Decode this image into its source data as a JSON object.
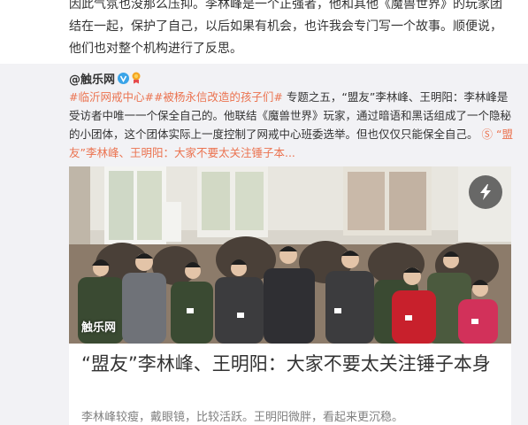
{
  "intro": {
    "lines": [
      "因此气氛也没那么压抑。李林峰是一个正强者，他和其他《魔兽世界》的玩家团",
      "结在一起，保护了自己，以后如果有机会，也许我会专门写一个故事。顺便说，",
      "他们也对整个机构进行了反思。"
    ]
  },
  "repost": {
    "author": "@触乐网",
    "topic1": "#临沂网戒中心#",
    "topic2": "#被杨永信改造的孩子们#",
    "text_a": " 专题之五，“盟友”李林峰、王明阳：李林峰是受访者中唯一一个保全自己的。他联结《魔兽世界》玩家，通过暗语和黑话组成了一个隐秘的小团体，这个团体实际上一度控制了网戒中心班委选举。但也仅仅只能保全自己。",
    "link_icon": "Ⓢ",
    "link_text": "“盟友”李林峰、王明阳：大家不要太关注锤子本...",
    "card": {
      "watermark": "触乐网",
      "title": "“盟友”李林峰、王明阳：大家不要太关注锤子本身",
      "subtitle": "李林峰较瘦，戴眼镜，比较活跃。王明阳微胖，看起来更沉稳。"
    }
  },
  "colors": {
    "link": "#eb7350",
    "repost_bg": "#f2f2f5"
  }
}
